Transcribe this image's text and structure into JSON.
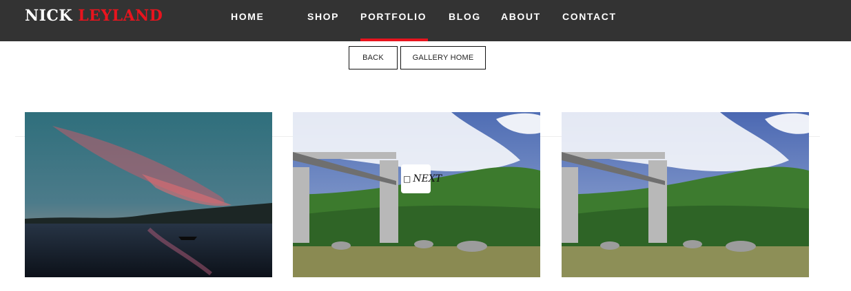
{
  "brand": {
    "first": "NICK",
    "last": "LEYLAND"
  },
  "nav": {
    "items": [
      {
        "label": "HOME"
      },
      {
        "label": "SHOP"
      },
      {
        "label": "PORTFOLIO",
        "active": true
      },
      {
        "label": "BLOG"
      },
      {
        "label": "ABOUT"
      },
      {
        "label": "CONTACT"
      }
    ]
  },
  "gallery_controls": {
    "back_label": "BACK",
    "gallery_home_label": "GALLERY HOME"
  },
  "photos": [
    {
      "description": "sunset over lake with small boat"
    },
    {
      "description": "concrete intake tower with bridge and green hillside"
    },
    {
      "description": "concrete intake tower with bridge and green hillside"
    }
  ],
  "overlay": {
    "next_label": "NEXT",
    "arrow_icon": "chevron-right-icon"
  },
  "colors": {
    "topbar": "#333333",
    "accent": "#e8141e"
  }
}
